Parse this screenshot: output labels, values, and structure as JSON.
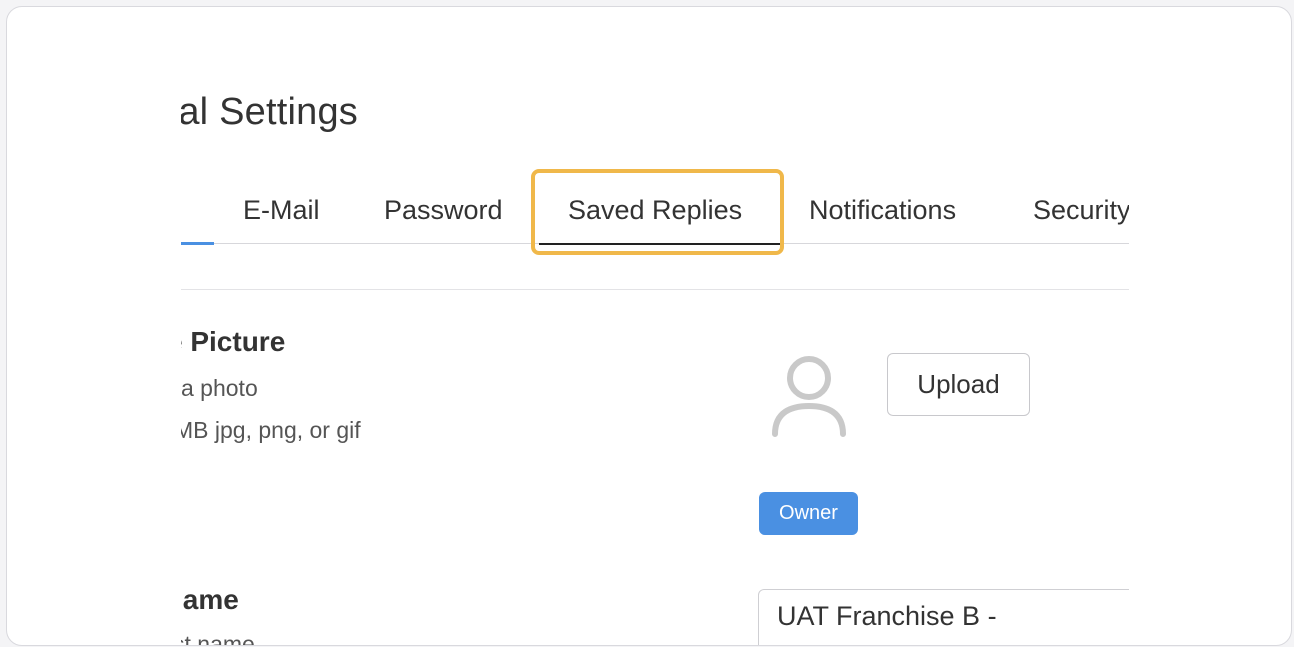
{
  "header": {
    "title": "nal Settings"
  },
  "tabs": [
    {
      "label": "E-Mail"
    },
    {
      "label": "Password"
    },
    {
      "label": "Saved Replies"
    },
    {
      "label": "Notifications"
    },
    {
      "label": "Security"
    }
  ],
  "profile_picture": {
    "title": "e Picture",
    "line1": "a photo",
    "line2": "MB jpg, png, or gif",
    "avatar_icon": "user-outline-icon",
    "upload_label": "Upload",
    "badge": "Owner"
  },
  "name_section": {
    "title": "lame",
    "subtitle": "st name",
    "value": "UAT Franchise B -"
  },
  "colors": {
    "accent": "#4a90e2",
    "highlight": "#f0b84a",
    "text": "#333333"
  }
}
